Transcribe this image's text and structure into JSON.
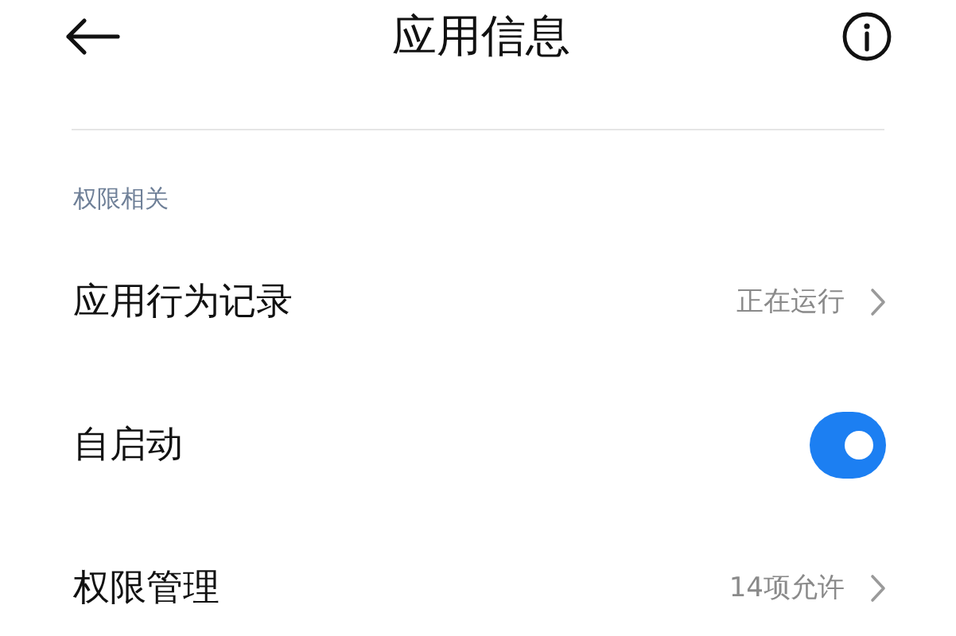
{
  "header": {
    "title": "应用信息"
  },
  "section": {
    "label": "权限相关"
  },
  "items": [
    {
      "kind": "link",
      "label": "应用行为记录",
      "value": "正在运行"
    },
    {
      "kind": "toggle",
      "label": "自启动",
      "on": true
    },
    {
      "kind": "link",
      "label": "权限管理",
      "value": "14项允许"
    }
  ]
}
